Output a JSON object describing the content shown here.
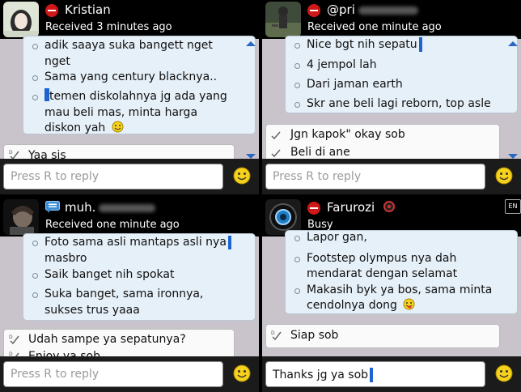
{
  "chats": [
    {
      "contact_name": "Kristian",
      "status_line": "Received 3 minutes ago",
      "received_lines": [
        "adik saaya suka bangett nget",
        "nget",
        "Sama yang century blacknya..",
        "temen diskolahnya jg ada yang",
        "mau beli mas, minta harga",
        "diskon yah"
      ],
      "sent_messages": [
        "Yaa sis"
      ],
      "reply_placeholder": "Press R to reply",
      "reply_value": ""
    },
    {
      "contact_name": "@pri",
      "status_line": "Received one minute ago",
      "received_lines": [
        "Nice bgt nih sepatu",
        "4 jempol lah",
        "Dari jaman earth",
        "Skr ane beli lagi reborn, top asle"
      ],
      "sent_messages": [
        "Jgn kapok\" okay sob",
        "Beli di ane"
      ],
      "reply_placeholder": "Press R to reply",
      "reply_value": ""
    },
    {
      "contact_name": "muh.",
      "status_line": "Received one minute ago",
      "received_lines": [
        "Foto sama asli mantaps asli nya",
        "masbro",
        "Saik banget nih spokat",
        "Suka banget, sama ironnya,",
        "sukses trus yaaa"
      ],
      "sent_messages": [
        "Udah sampe ya sepatunya?",
        "Enjoy ya sob"
      ],
      "reply_placeholder": "Press R to reply",
      "reply_value": ""
    },
    {
      "contact_name": "Farurozi",
      "status_line": "Busy",
      "received_lines": [
        "Lapor gan,",
        "Footstep olympus nya dah",
        "mendarat dengan selamat",
        "Makasih byk ya bos, sama minta",
        "cendolnya dong"
      ],
      "sent_messages": [
        "Siap sob"
      ],
      "reply_placeholder": "Press R to reply",
      "reply_value": "Thanks jg ya sob",
      "corner_badge": "EN"
    }
  ],
  "colors": {
    "received_bubble": "#e6f0f8",
    "background": "#c9c4cb",
    "busy": "#d01818",
    "caret": "#1e64d0"
  }
}
